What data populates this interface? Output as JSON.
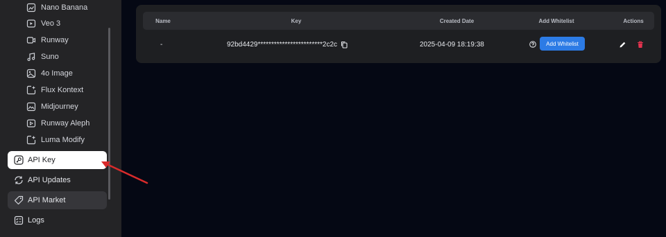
{
  "sidebar": {
    "sub_items": [
      {
        "label": "Nano Banana",
        "icon": "image-edit-icon"
      },
      {
        "label": "Veo 3",
        "icon": "video-play-icon"
      },
      {
        "label": "Runway",
        "icon": "video-camera-icon"
      },
      {
        "label": "Suno",
        "icon": "music-note-icon"
      },
      {
        "label": "4o Image",
        "icon": "image-icon"
      },
      {
        "label": "Flux Kontext",
        "icon": "image-sparkle-icon"
      },
      {
        "label": "Midjourney",
        "icon": "image-gallery-icon"
      },
      {
        "label": "Runway Aleph",
        "icon": "video-edit-icon"
      },
      {
        "label": "Luma Modify",
        "icon": "image-modify-icon"
      }
    ],
    "nav_items": [
      {
        "label": "API Key",
        "icon": "key-icon",
        "state": "active"
      },
      {
        "label": "API Updates",
        "icon": "refresh-icon",
        "state": "normal"
      },
      {
        "label": "API Market",
        "icon": "tag-icon",
        "state": "hover"
      },
      {
        "label": "Logs",
        "icon": "checklist-icon",
        "state": "normal"
      }
    ]
  },
  "table": {
    "columns": [
      "Name",
      "Key",
      "Created Date",
      "Add Whitelist",
      "Actions"
    ],
    "rows": [
      {
        "name": "-",
        "key": "92bd4429************************2c2c",
        "created_date": "2025-04-09 18:19:38",
        "whitelist_button": "Add Whitelist"
      }
    ]
  },
  "colors": {
    "accent": "#2c7be5",
    "delete": "#e5334f",
    "annotation_arrow": "#d92b2b"
  }
}
